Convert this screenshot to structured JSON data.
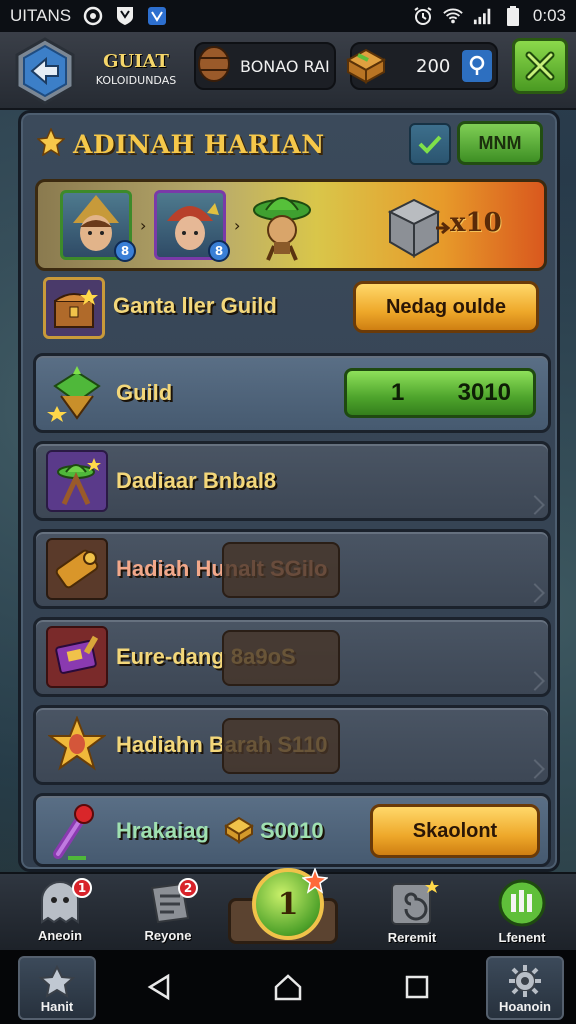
{
  "status_bar": {
    "carrier": "UITANS",
    "time": "0:03"
  },
  "header": {
    "guild_title": "GUIAT",
    "guild_subtitle": "KOLOIDUNDAS",
    "resource1_label": "BONAO RAI",
    "resource2_value": "200"
  },
  "panel": {
    "title": "ADINAH HARIAN",
    "max_label": "MNM"
  },
  "reward_banner": {
    "badge1": "8",
    "badge2": "8",
    "value": "x10"
  },
  "rows": [
    {
      "label": "Ganta ller Guild",
      "button": "Nedag oulde"
    },
    {
      "label": "Guild",
      "bar_left": "1",
      "bar_right": "3010"
    },
    {
      "label": "Dadiaar Bnbal8"
    },
    {
      "label": "Hadiah Hunalt SGilo"
    },
    {
      "label": "Eure-dang 8a9oS"
    },
    {
      "label": "Hadiahn Barah S110"
    },
    {
      "label": "Hrakaiag",
      "value": "S0010",
      "button": "Skaolont"
    }
  ],
  "bottom_nav": {
    "item1": {
      "label": "Aneoin",
      "badge": "1"
    },
    "item2": {
      "label": "Reyone",
      "badge": "2"
    },
    "center": "1",
    "item4": {
      "label": "Reremit"
    },
    "item5": {
      "label": "Lfenent"
    }
  },
  "android_nav": {
    "left_tile": "Hanit",
    "right_tile": "Hoanoin"
  }
}
